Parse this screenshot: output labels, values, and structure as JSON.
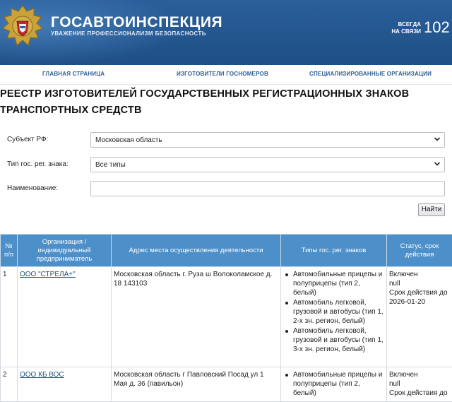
{
  "header": {
    "title": "ГОСАВТОИНСПЕКЦИЯ",
    "subtitle": "УВАЖЕНИЕ ПРОФЕССИОНАЛИЗМ БЕЗОПАСНОСТЬ",
    "always_line1": "ВСЕГДА",
    "always_line2": "НА СВЯЗИ",
    "phone": "102"
  },
  "nav": {
    "items": [
      {
        "label": "ГЛАВНАЯ СТРАНИЦА"
      },
      {
        "label": "ИЗГОТОВИТЕЛИ ГОСНОМЕРОВ"
      },
      {
        "label": "СПЕЦИАЛИЗИРОВАННЫЕ ОРГАНИЗАЦИИ"
      }
    ]
  },
  "page_title": {
    "line1": "РЕЕСТР ИЗГОТОВИТЕЛЕЙ ГОСУДАРСТВЕННЫХ РЕГИСТРАЦИОННЫХ ЗНАКОВ",
    "line2": "ТРАНСПОРТНЫХ СРЕДСТВ"
  },
  "form": {
    "region_label": "Субъект РФ:",
    "region_value": "Московская область",
    "type_label": "Тип гос. рег. знака:",
    "type_value": "Все типы",
    "name_label": "Наименование:",
    "name_value": "",
    "search_button": "Найти"
  },
  "table": {
    "headers": {
      "num": "№ п/п",
      "org": "Организация / индивидуальный предприниматель",
      "address": "Адрес места осуществления деятельности",
      "types": "Типы гос. рег. знаков",
      "status": "Статус, срок действия"
    },
    "rows": [
      {
        "num": "1",
        "org": "ООО \"СТРЕЛА+\"",
        "address": "Московская область г. Руза ш Волоколамское д. 18 143103",
        "types": [
          "Автомобильные прицепы и полуприцепы (тип 2, белый)",
          "Автомобиль легковой, грузовой и автобусы (тип 1, 2-х зн. регион, белый)",
          "Автомобиль легковой, грузовой и автобусы (тип 1, 3-х зн. регион, белый)"
        ],
        "status_line1": "Включен",
        "status_line2": "null",
        "status_line3": "Срок действия до 2026-01-20"
      },
      {
        "num": "2",
        "org": "ООО КБ ВОС",
        "address": "Московская область г Павловский Посад ул 1 Мая д. 36 (павильон)",
        "types": [
          "Автомобильные прицепы и полуприцепы (тип 2, белый)"
        ],
        "status_line1": "Включен",
        "status_line2": "null",
        "status_line3": "Срок действия до"
      }
    ]
  },
  "colors": {
    "header_bg": "#1f4f86",
    "nav_text": "#2b5e96",
    "table_header_bg": "#4d8fc9"
  },
  "icons": {
    "emblem": "traffic-police-emblem",
    "select_arrow": "chevron-down-icon"
  }
}
